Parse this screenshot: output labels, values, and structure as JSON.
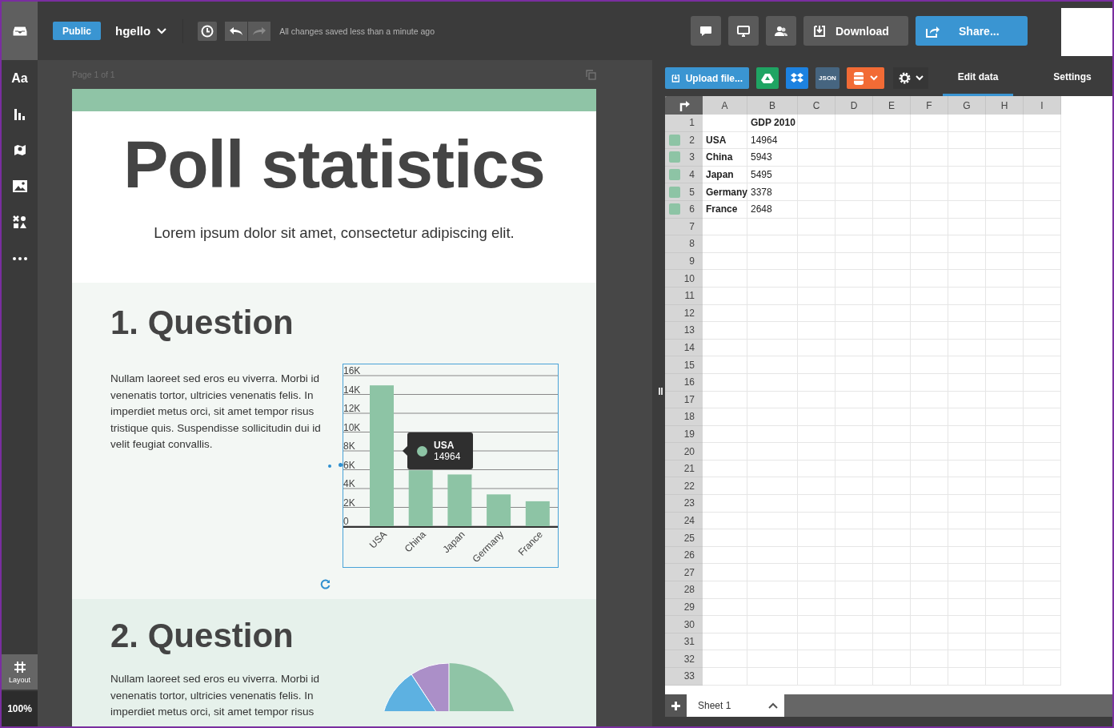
{
  "sidebar": {
    "items": [
      {
        "selected": true
      },
      {
        "text": "Aa",
        "selected": false
      },
      {
        "selected": false
      },
      {
        "selected": false
      },
      {
        "selected": false
      },
      {
        "selected": false
      },
      {
        "selected": false
      }
    ],
    "layout": {
      "label": "Layout",
      "selected": true
    },
    "zoom": "100%"
  },
  "toolbar": {
    "visibility": "Public",
    "document": "hgello",
    "history": [
      {
        "kind": "undo",
        "disabled": false
      },
      {
        "kind": "redo",
        "disabled": true
      }
    ],
    "status": "All changes saved less than a minute ago",
    "actions": [
      {
        "kind": "comment"
      },
      {
        "kind": "present"
      },
      {
        "kind": "collaborators"
      }
    ],
    "download": "Download",
    "share": "Share..."
  },
  "canvas": {
    "page_label": "Page 1 of 1",
    "title": "Poll statistics",
    "subtitle": "Lorem ipsum dolor sit amet, consectetur adipiscing elit.",
    "sections": [
      {
        "heading": "1. Question",
        "text": "Nullam laoreet sed eros eu viverra. Morbi id venenatis tortor, ultricies venenatis felis. In imperdiet metus orci, sit amet tempor risus tristique quis. Suspendisse sollicitudin dui id velit feugiat convallis.",
        "kind": "bar",
        "chart_data": {
          "type": "bar",
          "grid": true,
          "categories": [
            "USA",
            "China",
            "Japan",
            "Germany",
            "France"
          ],
          "values": [
            14964,
            5943,
            5495,
            3378,
            2648
          ],
          "ylim": [
            0,
            16000
          ],
          "yticks": [
            {
              "value": 0,
              "label": "0"
            },
            {
              "value": 2000,
              "label": "2K"
            },
            {
              "value": 4000,
              "label": "4K"
            },
            {
              "value": 6000,
              "label": "6K"
            },
            {
              "value": 8000,
              "label": "8K"
            },
            {
              "value": 10000,
              "label": "10K"
            },
            {
              "value": 12000,
              "label": "12K"
            },
            {
              "value": 14000,
              "label": "14K"
            },
            {
              "value": 16000,
              "label": "16K"
            }
          ]
        },
        "tooltip": {
          "label": "USA",
          "value": "14964"
        }
      },
      {
        "heading": "2. Question",
        "text": "Nullam laoreet sed eros eu viverra. Morbi id venenatis tortor, ultricies venenatis felis. In imperdiet metus orci, sit amet tempor risus",
        "kind": "pie"
      }
    ]
  },
  "data_panel": {
    "upload": "Upload file...",
    "sources": [
      {
        "kind": "drive"
      },
      {
        "kind": "dropbox"
      },
      {
        "kind": "json",
        "label": "JSON"
      },
      {
        "kind": "database"
      }
    ],
    "tabs": [
      {
        "label": "Edit data",
        "selected": true
      },
      {
        "label": "Settings",
        "selected": false
      }
    ],
    "sheet": {
      "columns": [
        "A",
        "B",
        "C",
        "D",
        "E",
        "F",
        "G",
        "H",
        "I"
      ],
      "rows": [
        {
          "num": "1",
          "b": "GDP 2010"
        },
        {
          "num": "2",
          "color": "#8dc4a5",
          "a": "USA",
          "b": "14964"
        },
        {
          "num": "3",
          "color": "#8dc4a5",
          "a": "China",
          "b": "5943"
        },
        {
          "num": "4",
          "color": "#8dc4a5",
          "a": "Japan",
          "b": "5495"
        },
        {
          "num": "5",
          "color": "#8dc4a5",
          "a": "Germany",
          "b": "3378"
        },
        {
          "num": "6",
          "color": "#8dc4a5",
          "a": "France",
          "b": "2648"
        },
        {
          "num": "7"
        },
        {
          "num": "8"
        },
        {
          "num": "9"
        },
        {
          "num": "10"
        },
        {
          "num": "11"
        },
        {
          "num": "12"
        },
        {
          "num": "13"
        },
        {
          "num": "14"
        },
        {
          "num": "15"
        },
        {
          "num": "16"
        },
        {
          "num": "17"
        },
        {
          "num": "18"
        },
        {
          "num": "19"
        },
        {
          "num": "20"
        },
        {
          "num": "21"
        },
        {
          "num": "22"
        },
        {
          "num": "23"
        },
        {
          "num": "24"
        },
        {
          "num": "25"
        },
        {
          "num": "26"
        },
        {
          "num": "27"
        },
        {
          "num": "28"
        },
        {
          "num": "29"
        },
        {
          "num": "30"
        },
        {
          "num": "31"
        },
        {
          "num": "32"
        },
        {
          "num": "33"
        }
      ],
      "tab": "Sheet 1"
    }
  }
}
